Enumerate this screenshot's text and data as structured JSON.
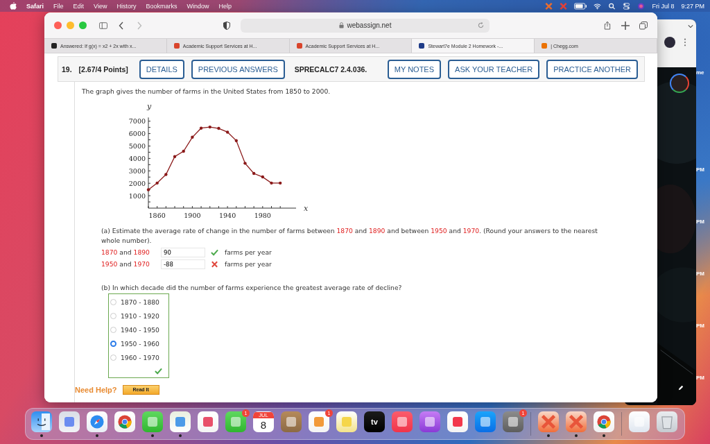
{
  "menu_bar": {
    "app": "Safari",
    "menus": [
      "File",
      "Edit",
      "View",
      "History",
      "Bookmarks",
      "Window",
      "Help"
    ],
    "date": "Fri Jul 8",
    "time": "9:27 PM"
  },
  "desktop_labels": [
    "me",
    "PM",
    "PM",
    "PM",
    "PM",
    "PM"
  ],
  "browser": {
    "address": "webassign.net",
    "tabs": [
      {
        "title": "Answered: If g(x) = x2 + 2x with x...",
        "selected": false,
        "color": "#222222"
      },
      {
        "title": "Academic Support Services at H...",
        "selected": false,
        "color": "#d9442b"
      },
      {
        "title": "Academic Support Services at H...",
        "selected": false,
        "color": "#d9442b"
      },
      {
        "title": "Stewart7e Module 2 Homework -...",
        "selected": true,
        "color": "#1f3c88"
      },
      {
        "title": "| Chegg.com",
        "selected": false,
        "color": "#eb7100"
      }
    ]
  },
  "question": {
    "number": "19.",
    "points": "[2.67/4 Points]",
    "code": "SPRECALC7 2.4.036.",
    "left_buttons": [
      "DETAILS",
      "PREVIOUS ANSWERS"
    ],
    "right_buttons": [
      "MY NOTES",
      "ASK YOUR TEACHER",
      "PRACTICE ANOTHER"
    ],
    "intro": "The graph gives the number of farms in the United States from 1850 to 2000.",
    "chart_data": {
      "type": "line",
      "xlabel": "x",
      "ylabel": "y",
      "x": [
        1850,
        1860,
        1870,
        1880,
        1890,
        1900,
        1910,
        1920,
        1930,
        1940,
        1950,
        1960,
        1970,
        1980,
        1990,
        2000
      ],
      "series": [
        {
          "color": "#8b1a1a",
          "values": [
            1480,
            2020,
            2710,
            4150,
            4580,
            5710,
            6440,
            6530,
            6420,
            6120,
            5430,
            3610,
            2790,
            2510,
            2020,
            2020
          ]
        }
      ],
      "xlim": [
        1850,
        2018
      ],
      "ylim": [
        0,
        7300
      ],
      "xticks": [
        1860,
        1900,
        1940,
        1980
      ],
      "yticks": [
        1000,
        2000,
        3000,
        4000,
        5000,
        6000,
        7000
      ]
    },
    "part_a": {
      "prompt": [
        {
          "text": "(a) Estimate the average rate of change in the number of farms between ",
          "highlight": false
        },
        {
          "text": "1870",
          "highlight": true
        },
        {
          "text": " and ",
          "highlight": false
        },
        {
          "text": "1890",
          "highlight": true
        },
        {
          "text": " and between ",
          "highlight": false
        },
        {
          "text": "1950",
          "highlight": true
        },
        {
          "text": " and ",
          "highlight": false
        },
        {
          "text": "1970",
          "highlight": true
        },
        {
          "text": ". (Round your answers to the nearest whole number).",
          "highlight": false
        }
      ],
      "answers": [
        {
          "from": "1870",
          "joiner": "and",
          "to": "1890",
          "value": "90",
          "correct": true,
          "unit": "farms per year"
        },
        {
          "from": "1950",
          "joiner": "and",
          "to": "1970",
          "value": "-88",
          "correct": false,
          "unit": "farms per year"
        }
      ]
    },
    "part_b": {
      "prompt": "(b) In which decade did the number of farms experience the greatest average rate of decline?",
      "correct": true,
      "options": [
        {
          "label": "1870 - 1880",
          "selected": false
        },
        {
          "label": "1910 - 1920",
          "selected": false
        },
        {
          "label": "1940 - 1950",
          "selected": false
        },
        {
          "label": "1950 - 1960",
          "selected": true
        },
        {
          "label": "1960 - 1970",
          "selected": false
        }
      ]
    },
    "help": {
      "label": "Need Help?",
      "button": "Read It"
    }
  },
  "dock": [
    {
      "kind": "finder",
      "running": true
    },
    {
      "kind": "launchpad",
      "running": false
    },
    {
      "kind": "safari",
      "running": true
    },
    {
      "kind": "chrome",
      "running": false
    },
    {
      "kind": "messages",
      "running": true
    },
    {
      "kind": "maps",
      "running": true
    },
    {
      "kind": "photos",
      "running": false
    },
    {
      "kind": "facetime",
      "running": false,
      "badge": "1"
    },
    {
      "kind": "calendar",
      "running": false,
      "month": "JUL",
      "day": "8"
    },
    {
      "kind": "contacts",
      "running": false
    },
    {
      "kind": "reminders",
      "running": false,
      "badge": "1"
    },
    {
      "kind": "notes",
      "running": false
    },
    {
      "kind": "tv",
      "running": false,
      "label": "tv"
    },
    {
      "kind": "music",
      "running": false
    },
    {
      "kind": "podcasts",
      "running": false
    },
    {
      "kind": "news",
      "running": false
    },
    {
      "kind": "appstore",
      "running": false
    },
    {
      "kind": "settings",
      "running": false,
      "badge": "1"
    },
    {
      "kind": "separator"
    },
    {
      "kind": "xapp",
      "running": true
    },
    {
      "kind": "xapp",
      "running": true
    },
    {
      "kind": "chrome",
      "running": true
    },
    {
      "kind": "separator"
    },
    {
      "kind": "document",
      "running": false
    },
    {
      "kind": "trash",
      "running": false
    }
  ]
}
